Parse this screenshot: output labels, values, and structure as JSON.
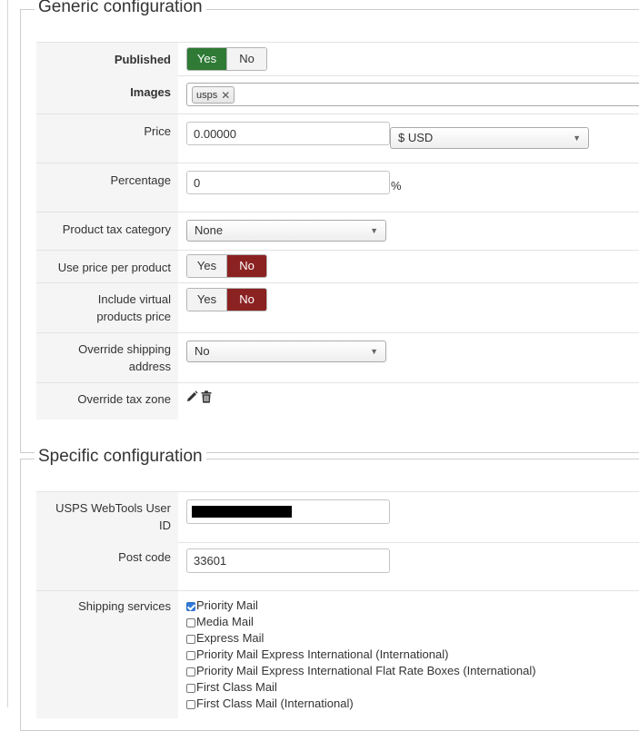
{
  "generic": {
    "legend": "Generic configuration",
    "published": {
      "label": "Published",
      "yes": "Yes",
      "no": "No",
      "selected": "Yes"
    },
    "images": {
      "label": "Images",
      "tags": [
        "usps"
      ]
    },
    "price": {
      "label": "Price",
      "value": "0.00000",
      "currency": "$ USD"
    },
    "percentage": {
      "label": "Percentage",
      "value": "0",
      "unit": "%"
    },
    "tax_category": {
      "label": "Product tax category",
      "value": "None"
    },
    "price_per_product": {
      "label": "Use price per product",
      "yes": "Yes",
      "no": "No",
      "selected": "No"
    },
    "virtual_products": {
      "label_line1": "Include virtual",
      "label_line2": "products price",
      "yes": "Yes",
      "no": "No",
      "selected": "No"
    },
    "override_shipping": {
      "label_line1": "Override shipping",
      "label_line2": "address",
      "value": "No"
    },
    "override_tax_zone": {
      "label": "Override tax zone"
    }
  },
  "specific": {
    "legend": "Specific configuration",
    "user_id": {
      "label_line1": "USPS WebTools User",
      "label_line2": "ID",
      "value": ""
    },
    "post_code": {
      "label": "Post code",
      "value": "33601"
    },
    "shipping_services": {
      "label": "Shipping services",
      "options": [
        {
          "label": "Priority Mail",
          "checked": true
        },
        {
          "label": "Media Mail",
          "checked": false
        },
        {
          "label": "Express Mail",
          "checked": false
        },
        {
          "label": "Priority Mail Express International (International)",
          "checked": false
        },
        {
          "label": "Priority Mail Express International Flat Rate Boxes (International)",
          "checked": false
        },
        {
          "label": "First Class Mail",
          "checked": false
        },
        {
          "label": "First Class Mail (International)",
          "checked": false
        }
      ]
    }
  },
  "colors": {
    "yes_active": "#2f7a35",
    "no_active": "#8b2222",
    "checkbox_checked": "#2f7ad8"
  },
  "icons": {
    "edit": "pencil-icon",
    "delete": "trash-icon"
  }
}
